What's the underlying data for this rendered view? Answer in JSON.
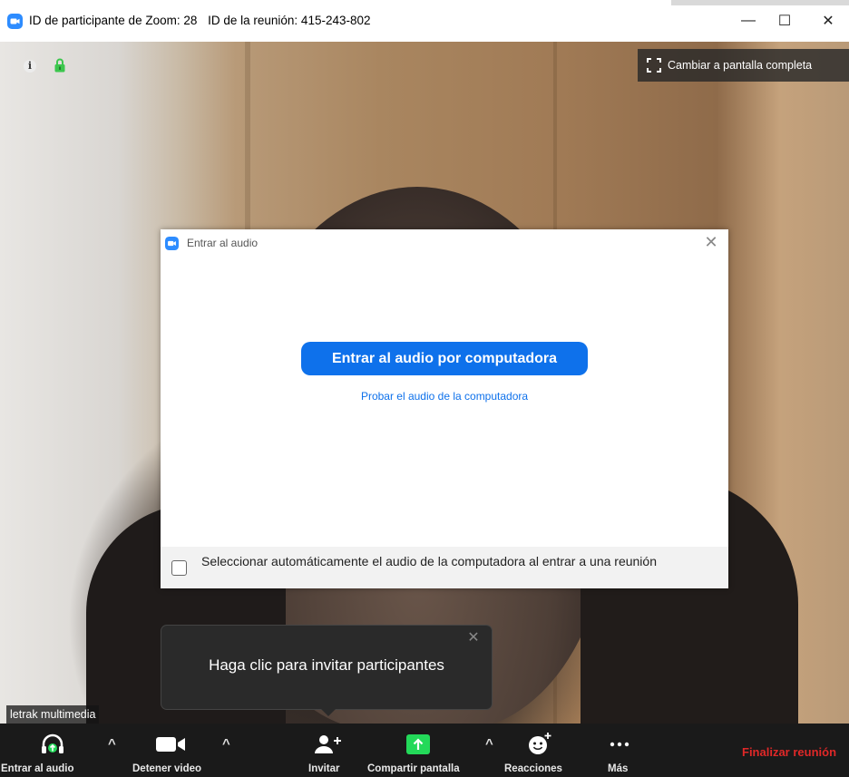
{
  "window": {
    "title_participant": "ID de participante de Zoom: 28",
    "title_meeting": "ID de la reunión: 415-243-802",
    "min_glyph": "—",
    "max_glyph": "☐",
    "close_glyph": "✕"
  },
  "video": {
    "fullscreen_label": "Cambiar a pantalla completa",
    "participant_name": "letrak multimedia"
  },
  "dialog": {
    "title": "Entrar al audio",
    "close_glyph": "✕",
    "join_button": "Entrar al audio por computadora",
    "test_link": "Probar el audio de la computadora",
    "auto_select_label": "Seleccionar automáticamente el audio de la computadora al entrar a una reunión",
    "auto_select_checked": false
  },
  "tooltip": {
    "text": "Haga clic para invitar participantes",
    "close_glyph": "✕"
  },
  "toolbar": {
    "join_audio": "Entrar al audio",
    "stop_video": "Detener video",
    "invite": "Invitar",
    "share_screen": "Compartir pantalla",
    "reactions": "Reacciones",
    "more": "Más",
    "end_meeting": "Finalizar reunión",
    "caret_glyph": "^"
  },
  "colors": {
    "accent": "#0e71eb",
    "share_green": "#23d959",
    "end_red": "#e02828",
    "lock_green": "#3cc64d"
  }
}
